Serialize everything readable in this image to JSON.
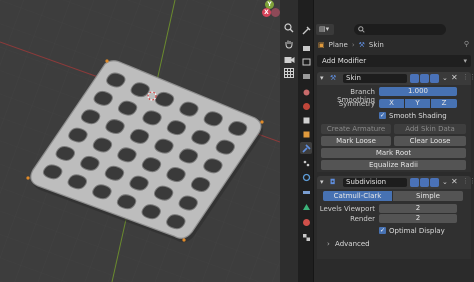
{
  "viewport": {
    "gizmo": {
      "x": "X",
      "y": "Y",
      "z": "Z"
    },
    "colors": {
      "background": "#3d3d3d",
      "mesh": "#bdbdbd",
      "axis_x": "#8b3a3a",
      "axis_y": "#6a8a2e",
      "vertex": "#e08a28"
    }
  },
  "properties": {
    "breadcrumb": {
      "object": "Plane",
      "modifier": "Skin"
    },
    "add_modifier": "Add Modifier",
    "skin": {
      "name": "Skin",
      "branch_smoothing_label": "Branch Smoothing",
      "branch_smoothing_value": "1.000",
      "symmetry_label": "Symmetry",
      "symmetry_axes": [
        "X",
        "Y",
        "Z"
      ],
      "smooth_shading_label": "Smooth Shading",
      "create_armature": "Create Armature",
      "add_skin_data": "Add Skin Data",
      "mark_loose": "Mark Loose",
      "clear_loose": "Clear Loose",
      "mark_root": "Mark Root",
      "equalize_radii": "Equalize Radii"
    },
    "subdivision": {
      "name": "Subdivision",
      "modes": [
        "Catmull-Clark",
        "Simple"
      ],
      "levels_viewport_label": "Levels Viewport",
      "levels_viewport_value": "2",
      "render_label": "Render",
      "render_value": "2",
      "optimal_display_label": "Optimal Display",
      "advanced_label": "Advanced"
    },
    "accent": "#4772b3"
  }
}
